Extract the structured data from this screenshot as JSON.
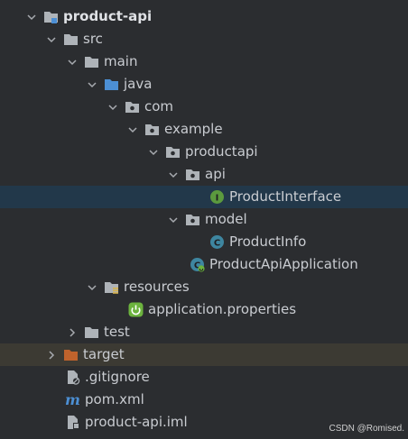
{
  "tree": {
    "rows": [
      {
        "label": "product-api",
        "icon": "module-folder-icon",
        "expanded": true
      },
      {
        "label": "src",
        "icon": "folder-icon",
        "expanded": true
      },
      {
        "label": "main",
        "icon": "folder-icon",
        "expanded": true
      },
      {
        "label": "java",
        "icon": "source-root-folder-icon",
        "expanded": true
      },
      {
        "label": "com",
        "icon": "package-icon",
        "expanded": true
      },
      {
        "label": "example",
        "icon": "package-icon",
        "expanded": true
      },
      {
        "label": "productapi",
        "icon": "package-icon",
        "expanded": true
      },
      {
        "label": "api",
        "icon": "package-icon",
        "expanded": true
      },
      {
        "label": "ProductInterface",
        "icon": "interface-icon",
        "selected": true
      },
      {
        "label": "model",
        "icon": "package-icon",
        "expanded": true
      },
      {
        "label": "ProductInfo",
        "icon": "class-icon"
      },
      {
        "label": "ProductApiApplication",
        "icon": "spring-boot-class-icon"
      },
      {
        "label": "resources",
        "icon": "resources-folder-icon",
        "expanded": true
      },
      {
        "label": "application.properties",
        "icon": "spring-properties-icon"
      },
      {
        "label": "test",
        "icon": "folder-icon",
        "expanded": false
      },
      {
        "label": "target",
        "icon": "excluded-folder-icon",
        "expanded": false
      },
      {
        "label": ".gitignore",
        "icon": "gitignore-file-icon"
      },
      {
        "label": "pom.xml",
        "icon": "maven-icon"
      },
      {
        "label": "product-api.iml",
        "icon": "iml-file-icon"
      }
    ]
  },
  "colors": {
    "background": "#2b2d30",
    "selected_row": "#22384a",
    "excluded_row": "#3c3a33",
    "folder": "#aeb3b8",
    "source_folder": "#4c8fd4",
    "excluded_folder": "#c0632c",
    "class": "#3e86a0",
    "interface": "#5b9a3e",
    "spring": "#6cb33e"
  },
  "watermark": "CSDN @Romised."
}
